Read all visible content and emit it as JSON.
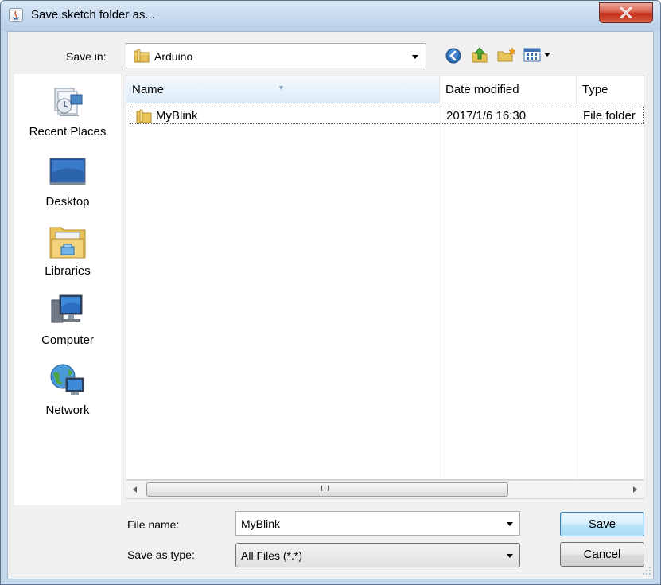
{
  "window": {
    "title": "Save sketch folder as..."
  },
  "save_in": {
    "label": "Save in:",
    "value": "Arduino"
  },
  "toolbar": {
    "icons": [
      "back-icon",
      "up-folder-icon",
      "new-folder-icon",
      "view-menu-icon"
    ]
  },
  "places": [
    {
      "label": "Recent Places",
      "icon": "recent-places-icon"
    },
    {
      "label": "Desktop",
      "icon": "desktop-icon"
    },
    {
      "label": "Libraries",
      "icon": "libraries-icon"
    },
    {
      "label": "Computer",
      "icon": "computer-icon"
    },
    {
      "label": "Network",
      "icon": "network-icon"
    }
  ],
  "file_list": {
    "columns": [
      "Name",
      "Date modified",
      "Type"
    ],
    "rows": [
      {
        "name": "MyBlink",
        "date_modified": "2017/1/6 16:30",
        "type": "File folder"
      }
    ]
  },
  "scrollbar": {
    "grip": "III"
  },
  "file_name": {
    "label": "File name:",
    "value": "MyBlink"
  },
  "file_type": {
    "label": "Save as type:",
    "value": "All Files (*.*)"
  },
  "buttons": {
    "save": "Save",
    "cancel": "Cancel"
  },
  "colors": {
    "titlebar": "#c6d9ee",
    "close_button": "#c3301b",
    "default_button_border": "#3c7fb1",
    "folder": "#e8c35a"
  }
}
